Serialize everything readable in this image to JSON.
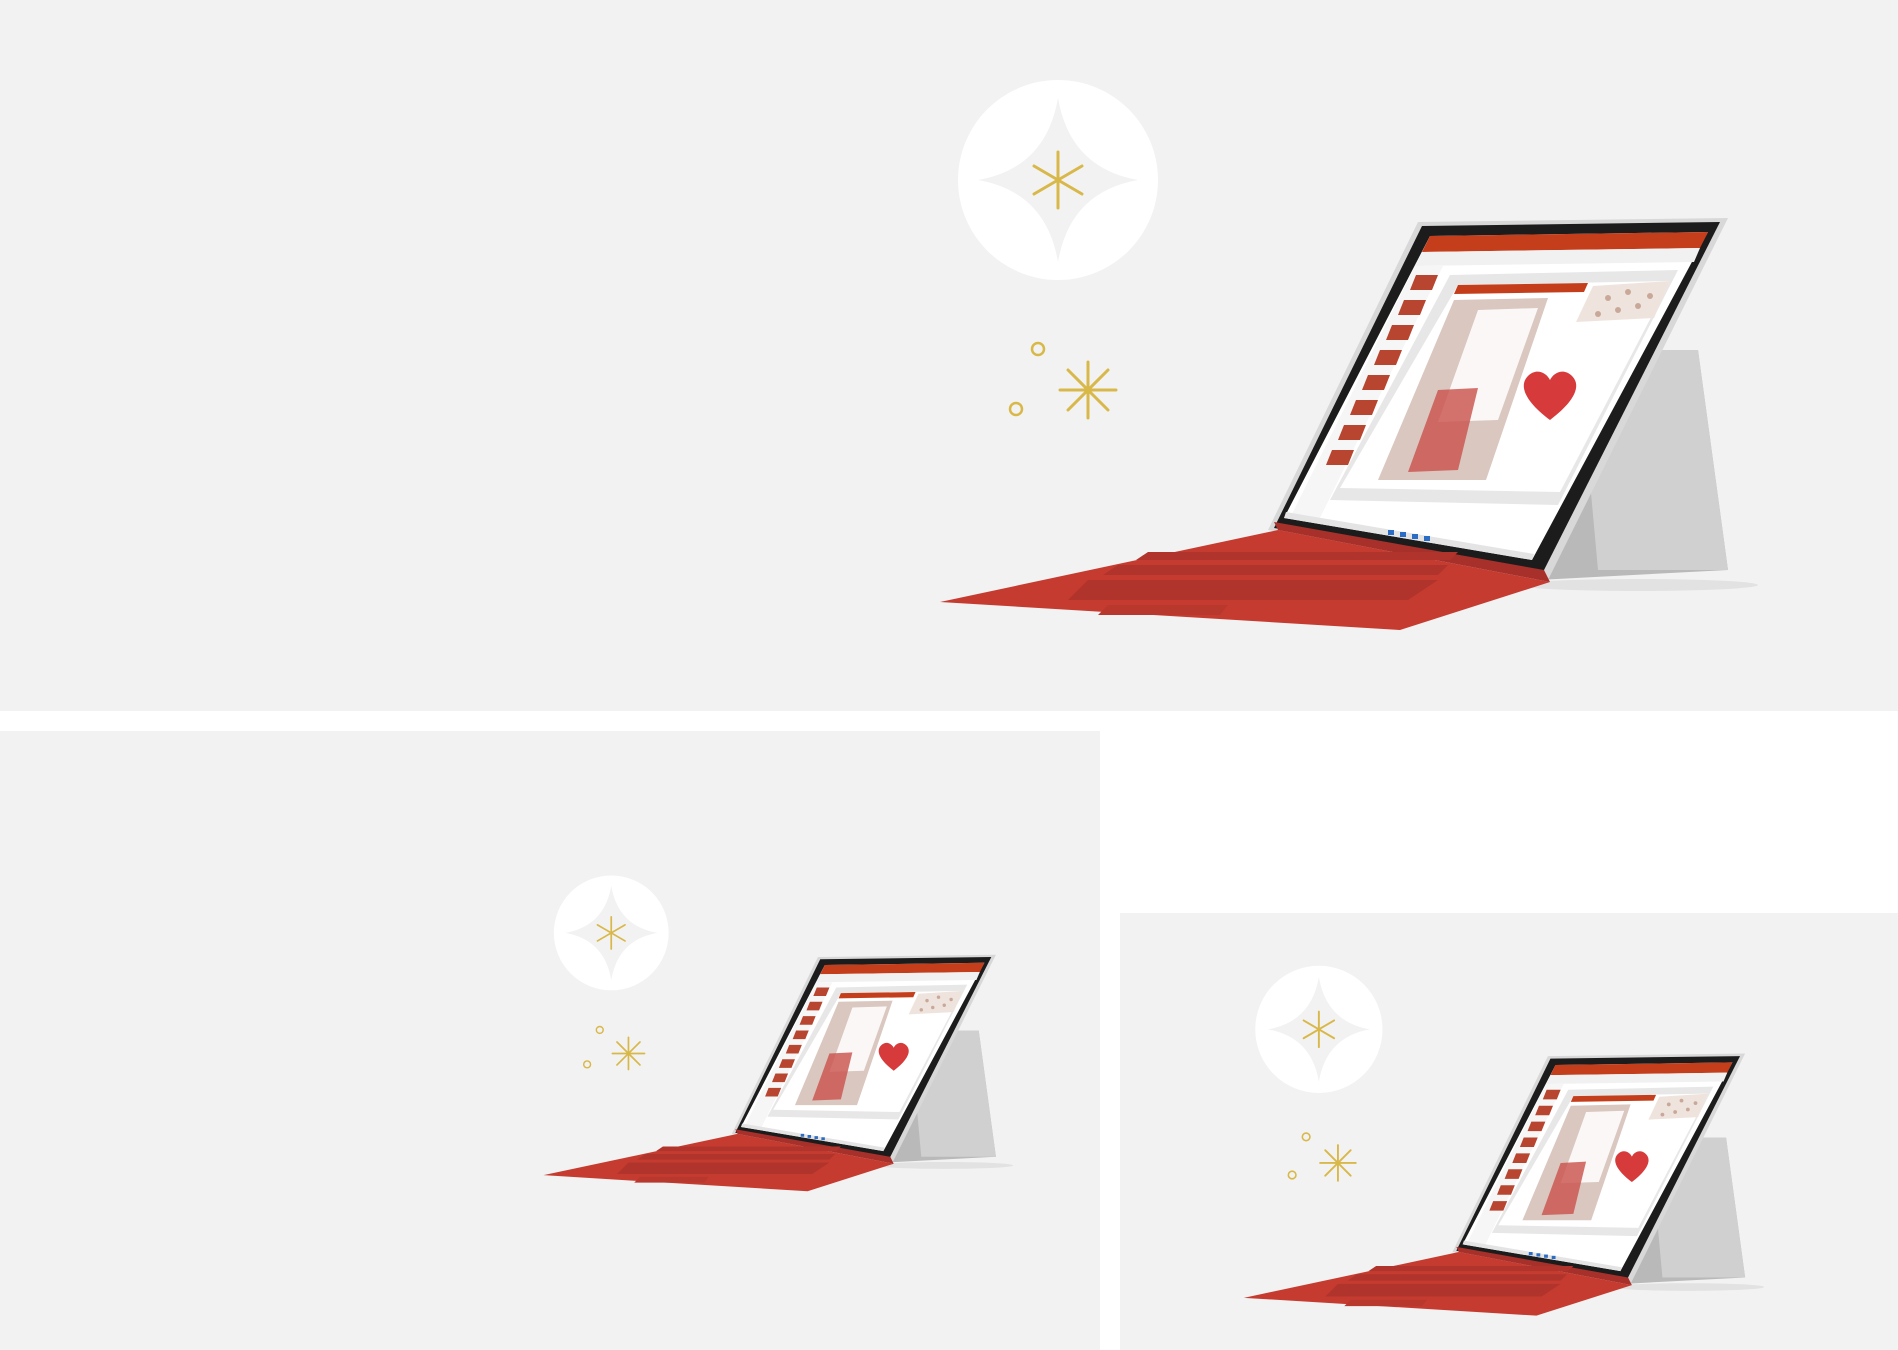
{
  "colors": {
    "background": "#f2f2f2",
    "page": "#ffffff",
    "accent_gold": "#d9b84a",
    "keyboard_red": "#c63b30",
    "device_silver": "#c9c9c9",
    "bezel_black": "#1c1c1c",
    "app_red": "#c43e1c",
    "heart_red": "#d63a3a"
  },
  "icons": [
    "sparkle-badge-icon",
    "sparkle-icon",
    "ring-icon",
    "heart-icon"
  ]
}
